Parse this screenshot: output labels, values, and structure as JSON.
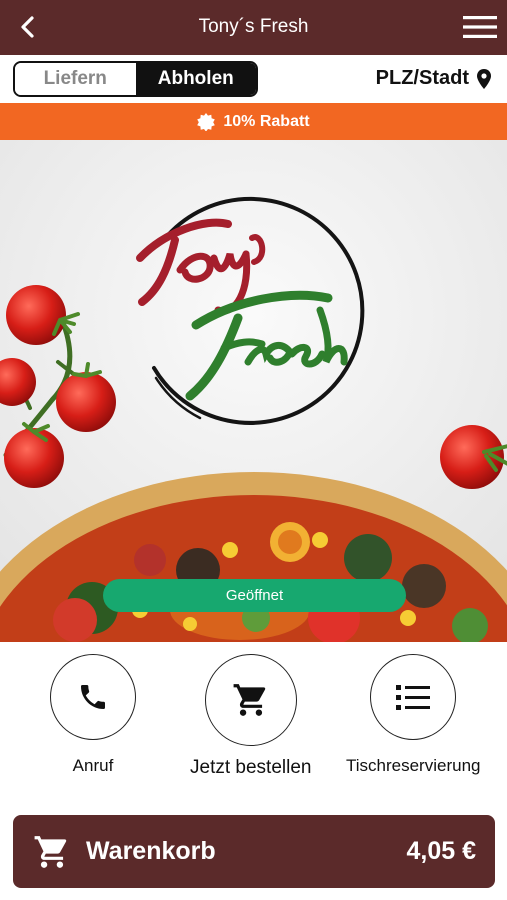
{
  "header": {
    "title": "Tony´s Fresh",
    "back_icon": "chevron-left-icon",
    "menu_icon": "hamburger-menu-icon"
  },
  "order_mode": {
    "options": [
      "Liefern",
      "Abholen"
    ],
    "selected": "Abholen"
  },
  "location": {
    "label": "PLZ/Stadt",
    "icon": "map-pin-icon"
  },
  "discount": {
    "label": "10% Rabatt",
    "icon": "badge-icon",
    "color": "#f26722"
  },
  "hero": {
    "status": "Geöffnet",
    "status_color": "#17a86f"
  },
  "actions": [
    {
      "label": "Anruf",
      "icon": "phone-icon"
    },
    {
      "label": "Jetzt bestellen",
      "icon": "cart-icon"
    },
    {
      "label": "Tischreservierung",
      "icon": "list-icon"
    }
  ],
  "cart": {
    "label": "Warenkorb",
    "total": "4,05 €",
    "icon": "cart-icon"
  },
  "colors": {
    "brand": "#5b2a2a",
    "accent": "#f26722",
    "open": "#17a86f"
  }
}
